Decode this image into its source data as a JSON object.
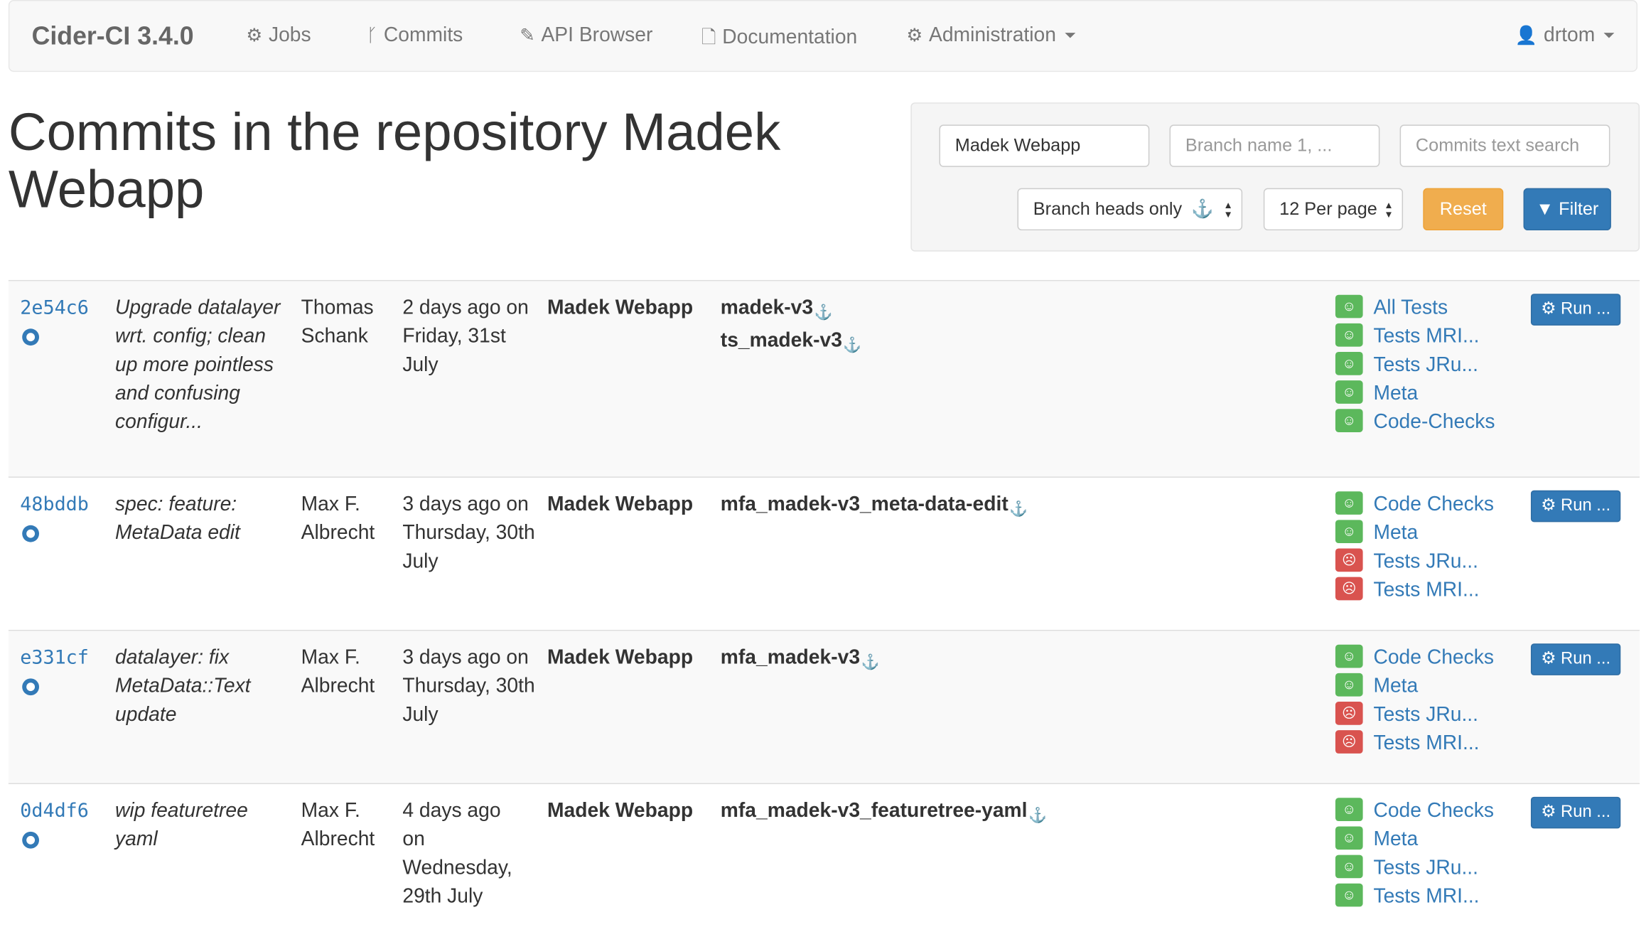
{
  "navbar": {
    "brand": "Cider-CI 3.4.0",
    "items": [
      {
        "label": "Jobs",
        "icon": "gear-icon"
      },
      {
        "label": "Commits",
        "icon": "code-fork-icon"
      },
      {
        "label": "API Browser",
        "icon": "magic-wand-icon"
      },
      {
        "label": "Documentation",
        "icon": "document-icon"
      },
      {
        "label": "Administration",
        "icon": "gear-icon"
      }
    ],
    "user": "drtom"
  },
  "page_title": "Commits in the repository Madek Webapp",
  "filter": {
    "repository_value": "Madek Webapp",
    "branch_placeholder": "Branch name 1, ...",
    "text_search_placeholder": "Commits text search",
    "branch_heads_select": "Branch heads only",
    "per_page_select": "12 Per page",
    "reset_label": "Reset",
    "filter_label": "Filter"
  },
  "commits": [
    {
      "sha": "2e54c6",
      "message": "Upgrade datalayer wrt. config; clean up more pointless and confusing configur...",
      "author": "Thomas Schank",
      "date": "2 days ago on Friday, 31st July",
      "repository": "Madek Webapp",
      "branches": [
        "madek-v3",
        "ts_madek-v3"
      ],
      "jobs": [
        {
          "name": "All Tests",
          "status": "passed"
        },
        {
          "name": "Tests MRI...",
          "status": "passed"
        },
        {
          "name": "Tests JRu...",
          "status": "passed"
        },
        {
          "name": "Meta",
          "status": "passed"
        },
        {
          "name": "Code-Checks",
          "status": "passed"
        }
      ],
      "run_label": "Run ..."
    },
    {
      "sha": "48bddb",
      "message": "spec: feature: MetaData edit",
      "author": "Max F. Albrecht",
      "date": "3 days ago on Thursday, 30th July",
      "repository": "Madek Webapp",
      "branches": [
        "mfa_madek-v3_meta-data-edit"
      ],
      "jobs": [
        {
          "name": "Code Checks",
          "status": "passed"
        },
        {
          "name": "Meta",
          "status": "passed"
        },
        {
          "name": "Tests JRu...",
          "status": "failed"
        },
        {
          "name": "Tests MRI...",
          "status": "failed"
        }
      ],
      "run_label": "Run ..."
    },
    {
      "sha": "e331cf",
      "message": "datalayer: fix MetaData::Text update",
      "author": "Max F. Albrecht",
      "date": "3 days ago on Thursday, 30th July",
      "repository": "Madek Webapp",
      "branches": [
        "mfa_madek-v3"
      ],
      "jobs": [
        {
          "name": "Code Checks",
          "status": "passed"
        },
        {
          "name": "Meta",
          "status": "passed"
        },
        {
          "name": "Tests JRu...",
          "status": "failed"
        },
        {
          "name": "Tests MRI...",
          "status": "failed"
        }
      ],
      "run_label": "Run ..."
    },
    {
      "sha": "0d4df6",
      "message": "wip featuretree yaml",
      "author": "Max F. Albrecht",
      "date": "4 days ago on Wednesday, 29th July",
      "repository": "Madek Webapp",
      "branches": [
        "mfa_madek-v3_featuretree-yaml"
      ],
      "jobs": [
        {
          "name": "Code Checks",
          "status": "passed"
        },
        {
          "name": "Meta",
          "status": "passed"
        },
        {
          "name": "Tests JRu...",
          "status": "passed"
        },
        {
          "name": "Tests MRI...",
          "status": "passed"
        }
      ],
      "run_label": "Run ..."
    }
  ],
  "colors": {
    "link": "#337ab7",
    "passed": "#5cb85c",
    "failed": "#d9534f",
    "warning": "#f0ad4e"
  }
}
